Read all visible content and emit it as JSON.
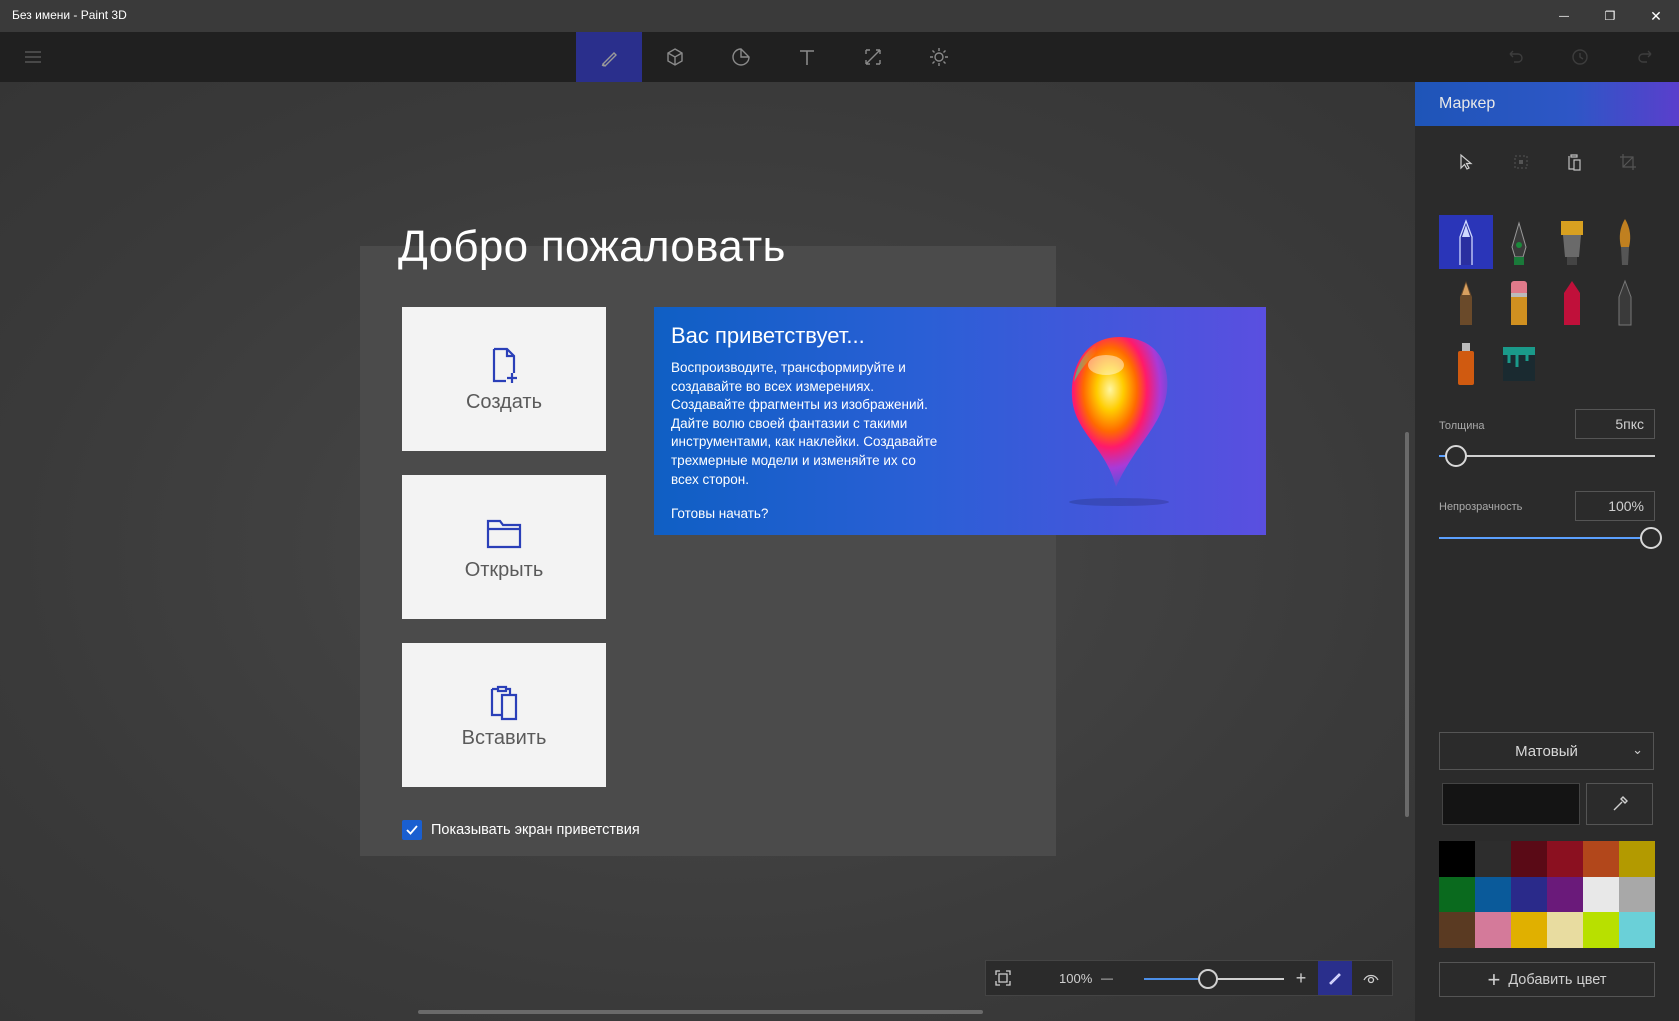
{
  "window": {
    "title": "Без имени - Paint 3D",
    "minimize": "—",
    "restore": "❐",
    "close": "✕"
  },
  "toolbar": {
    "tools": [
      {
        "icon": "brushes-icon",
        "active": true
      },
      {
        "icon": "3d-shapes-icon",
        "active": false
      },
      {
        "icon": "stickers-icon",
        "active": false
      },
      {
        "icon": "text-icon",
        "active": false
      },
      {
        "icon": "canvas-icon",
        "active": false
      },
      {
        "icon": "effects-icon",
        "active": false
      }
    ],
    "right_icons": [
      "undo-icon",
      "history-icon",
      "redo-icon"
    ]
  },
  "welcome": {
    "title": "Добро пожаловать",
    "tiles": {
      "create": "Создать",
      "open": "Открыть",
      "paste": "Вставить"
    },
    "promo": {
      "heading": "Вас приветствует...",
      "body": "Воспроизводите, трансформируйте и создавайте во всех измерениях. Создавайте фрагменты из изображений. Дайте волю своей фантазии с такими инструментами, как наклейки. Создавайте трехмерные модели и изменяйте их со всех сторон.",
      "cta": "Готовы начать?"
    },
    "show_welcome_label": "Показывать экран приветствия",
    "show_welcome_checked": true
  },
  "zoom": {
    "percent": "100%",
    "minus": "—",
    "plus": "+",
    "level": 0.46
  },
  "panel": {
    "title": "Маркер",
    "brushes": [
      "marker",
      "calligraphy-pen",
      "oil-brush",
      "watercolor",
      "pencil",
      "eraser",
      "crayon",
      "pixel-pen",
      "spray-can",
      "fill"
    ],
    "thickness_label": "Толщина",
    "thickness_value": "5пкс",
    "thickness_level": 0.08,
    "opacity_label": "Непрозрачность",
    "opacity_value": "100%",
    "opacity_level": 1.0,
    "finish": "Матовый",
    "current_color": "#141414",
    "palette": [
      "#000000",
      "#2d2d2d",
      "#5a0a16",
      "#8b1020",
      "#b2471b",
      "#b39a00",
      "#0a6a1e",
      "#0a5a9a",
      "#2a2a8a",
      "#6a1a7a",
      "#e8e8e8",
      "#a8a8a8",
      "#5a3a22",
      "#d47a9a",
      "#e0b000",
      "#e8dca0",
      "#b8e000",
      "#6ad0d8"
    ],
    "add_color": "Добавить цвет"
  }
}
